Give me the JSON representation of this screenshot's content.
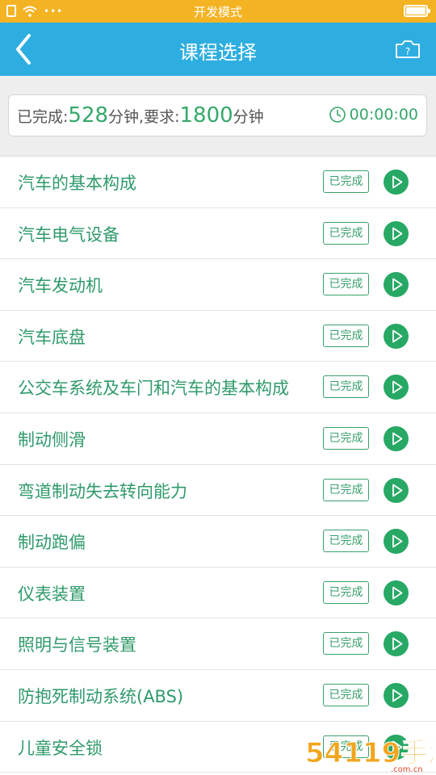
{
  "status_bar": {
    "title": "开发模式",
    "sim_icon": "sim-card-icon",
    "wifi_icon": "wifi-icon",
    "dots": "•••",
    "battery_icon": "battery-icon",
    "background_color": "#f4b323"
  },
  "nav": {
    "title": "课程选择",
    "back_icon": "chevron-left-icon",
    "camera_icon": "camera-help-icon",
    "camera_badge": "?",
    "background_color": "#2eaee0"
  },
  "summary": {
    "completed_label": "已完成:",
    "completed_minutes": "528",
    "unit1": "分钟,要求:",
    "required_minutes": "1800",
    "unit2": "分钟",
    "timer_icon": "clock-icon",
    "timer": "00:00:00",
    "accent_color": "#35a86a"
  },
  "courses": [
    {
      "title": "汽车的基本构成",
      "status": "已完成"
    },
    {
      "title": "汽车电气设备",
      "status": "已完成"
    },
    {
      "title": "汽车发动机",
      "status": "已完成"
    },
    {
      "title": "汽车底盘",
      "status": "已完成"
    },
    {
      "title": "公交车系统及车门和汽车的基本构成",
      "status": "已完成"
    },
    {
      "title": "制动侧滑",
      "status": "已完成"
    },
    {
      "title": "弯道制动失去转向能力",
      "status": "已完成"
    },
    {
      "title": "制动跑偏",
      "status": "已完成"
    },
    {
      "title": "仪表装置",
      "status": "已完成"
    },
    {
      "title": "照明与信号装置",
      "status": "已完成"
    },
    {
      "title": "防抱死制动系统(ABS)",
      "status": "已完成"
    },
    {
      "title": "儿童安全锁",
      "status": "已完成"
    }
  ],
  "watermark": {
    "text": "54119手游网",
    "url_text": ".com.cn"
  }
}
